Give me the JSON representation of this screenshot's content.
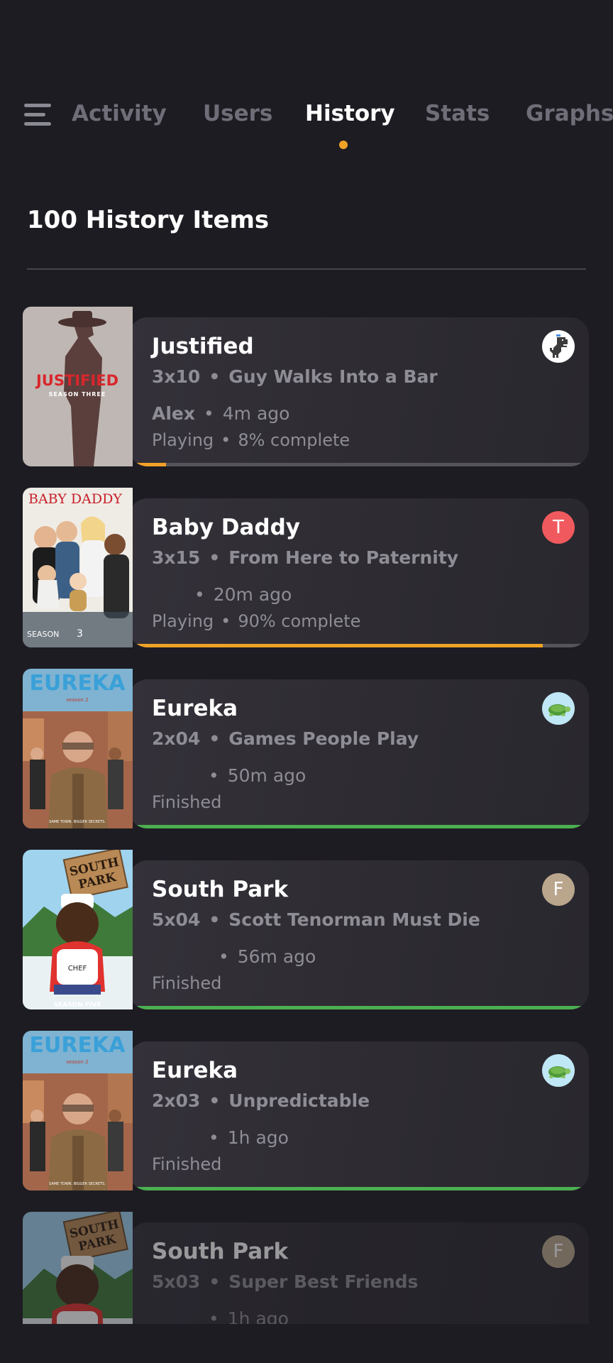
{
  "nav": {
    "tabs": [
      {
        "label": "Activity",
        "active": false
      },
      {
        "label": "Users",
        "active": false
      },
      {
        "label": "History",
        "active": true
      },
      {
        "label": "Stats",
        "active": false
      },
      {
        "label": "Graphs",
        "active": false
      }
    ]
  },
  "list": {
    "title": "100 History Items",
    "items": [
      {
        "show": "Justified",
        "episode": "3x10",
        "episode_title": "Guy Walks Into a Bar",
        "user": "Alex",
        "time": "4m ago",
        "state": "Playing",
        "complete": "8% complete",
        "progress": 0.08,
        "progress_color": "#f0a227",
        "avatar": {
          "type": "dino-icon",
          "letter": "",
          "bg": "#ffffff"
        },
        "poster": "justified-poster"
      },
      {
        "show": "Baby Daddy",
        "episode": "3x15",
        "episode_title": "From Here to Paternity",
        "user": "",
        "time": "20m ago",
        "state": "Playing",
        "complete": "90% complete",
        "progress": 0.9,
        "progress_color": "#f0a227",
        "avatar": {
          "type": "letter",
          "letter": "T",
          "bg": "#f05a5e"
        },
        "poster": "baby-daddy-poster"
      },
      {
        "show": "Eureka",
        "episode": "2x04",
        "episode_title": "Games People Play",
        "user": "",
        "time": "50m ago",
        "state": "Finished",
        "complete": "",
        "progress": 1.0,
        "progress_color": "#4caf50",
        "avatar": {
          "type": "turtle-icon",
          "letter": "",
          "bg": "#bfe7f5"
        },
        "poster": "eureka-poster"
      },
      {
        "show": "South Park",
        "episode": "5x04",
        "episode_title": "Scott Tenorman Must Die",
        "user": "",
        "time": "56m ago",
        "state": "Finished",
        "complete": "",
        "progress": 1.0,
        "progress_color": "#4caf50",
        "avatar": {
          "type": "letter",
          "letter": "F",
          "bg": "#b9a68d"
        },
        "poster": "south-park-poster"
      },
      {
        "show": "Eureka",
        "episode": "2x03",
        "episode_title": "Unpredictable",
        "user": "",
        "time": "1h ago",
        "state": "Finished",
        "complete": "",
        "progress": 1.0,
        "progress_color": "#4caf50",
        "avatar": {
          "type": "turtle-icon",
          "letter": "",
          "bg": "#bfe7f5"
        },
        "poster": "eureka-poster"
      },
      {
        "show": "South Park",
        "episode": "5x03",
        "episode_title": "Super Best Friends",
        "user": "",
        "time": "1h ago",
        "state": "",
        "complete": "",
        "progress": 0,
        "progress_color": "#4caf50",
        "avatar": {
          "type": "letter",
          "letter": "F",
          "bg": "#b9a68d"
        },
        "poster": "south-park-poster"
      }
    ]
  },
  "posters": {
    "justified": {
      "title": "JUSTIFIED",
      "subtitle": "SEASON THREE"
    },
    "baby_daddy": {
      "title": "BABY DADDY",
      "season_label": "SEASON",
      "season_num": "3"
    },
    "eureka": {
      "title": "EUREKA",
      "subtitle": "season 2",
      "tagline": "SAME TOWN. BIGGER SECRETS."
    },
    "south_park": {
      "title_line1": "SOUTH",
      "title_line2": "PARK",
      "chef": "CHEF",
      "season": "SEASON FIVE"
    }
  },
  "colors": {
    "accent": "#f0a227",
    "finished": "#4caf50",
    "background": "#1d1c22"
  }
}
